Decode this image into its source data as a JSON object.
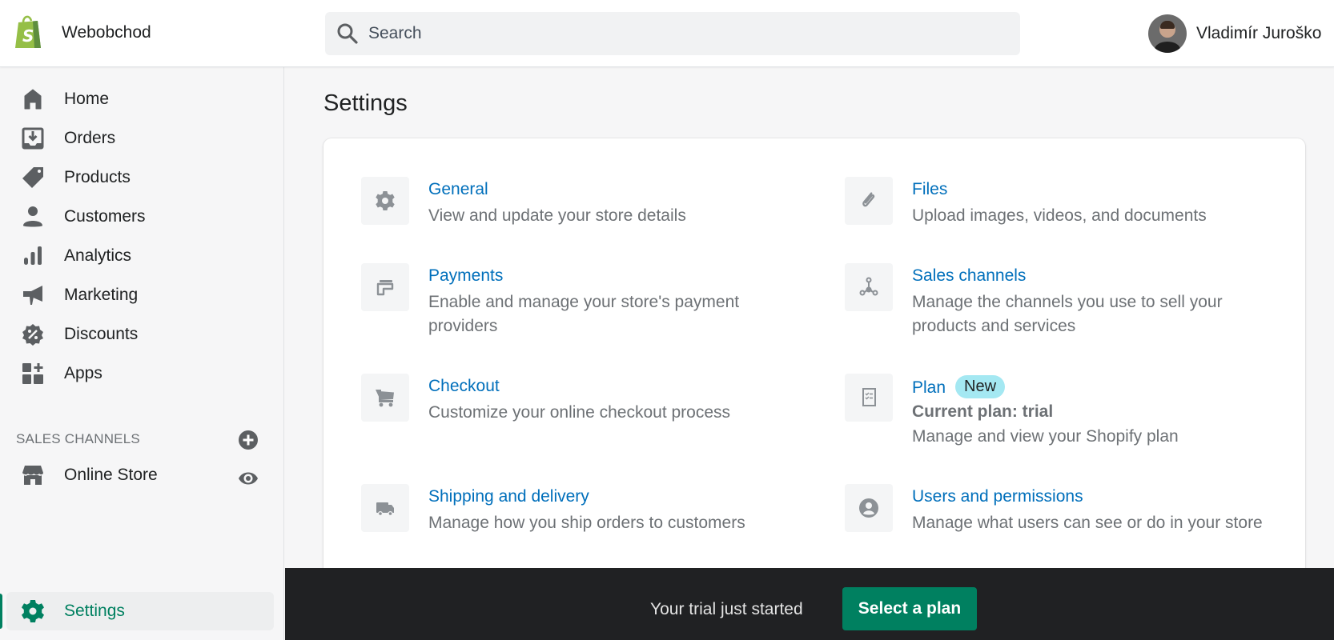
{
  "topbar": {
    "store_name": "Webobchod",
    "search_placeholder": "Search",
    "search_value": "",
    "user_name": "Vladimír Juroško"
  },
  "sidebar": {
    "items": [
      {
        "label": "Home",
        "icon": "home-icon"
      },
      {
        "label": "Orders",
        "icon": "orders-icon"
      },
      {
        "label": "Products",
        "icon": "tag-icon"
      },
      {
        "label": "Customers",
        "icon": "person-icon"
      },
      {
        "label": "Analytics",
        "icon": "bar-chart-icon"
      },
      {
        "label": "Marketing",
        "icon": "megaphone-icon"
      },
      {
        "label": "Discounts",
        "icon": "discount-icon"
      },
      {
        "label": "Apps",
        "icon": "apps-icon"
      }
    ],
    "sales_channels_title": "SALES CHANNELS",
    "channels": [
      {
        "label": "Online Store",
        "icon": "store-icon"
      }
    ],
    "settings_label": "Settings"
  },
  "page": {
    "title": "Settings"
  },
  "settings": [
    {
      "title": "General",
      "description": "View and update your store details",
      "icon": "gear-icon"
    },
    {
      "title": "Files",
      "description": "Upload images, videos, and documents",
      "icon": "paperclip-icon"
    },
    {
      "title": "Payments",
      "description": "Enable and manage your store's payment providers",
      "icon": "payments-icon"
    },
    {
      "title": "Sales channels",
      "description": "Manage the channels you use to sell your products and services",
      "icon": "channels-icon"
    },
    {
      "title": "Checkout",
      "description": "Customize your online checkout process",
      "icon": "cart-icon"
    },
    {
      "title": "Plan",
      "badge": "New",
      "subtitle": "Current plan: trial",
      "description": "Manage and view your Shopify plan",
      "icon": "checklist-icon"
    },
    {
      "title": "Shipping and delivery",
      "description": "Manage how you ship orders to customers",
      "icon": "truck-icon"
    },
    {
      "title": "Users and permissions",
      "description": "Manage what users can see or do in your store",
      "icon": "user-circle-icon"
    }
  ],
  "trial": {
    "text": "Your trial just started",
    "button": "Select a plan"
  },
  "colors": {
    "brand_green": "#008060",
    "link_blue": "#006fbb",
    "badge_bg": "#a4e8f2",
    "shopify_green": "#95bf47"
  }
}
